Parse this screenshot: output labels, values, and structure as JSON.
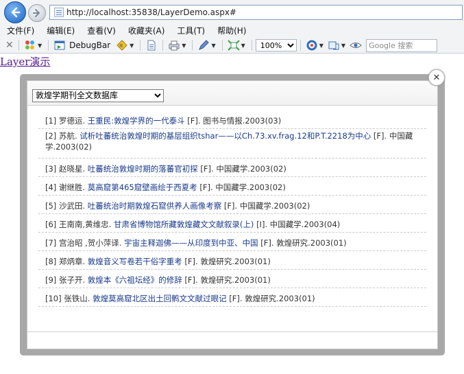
{
  "browser": {
    "url": "http://localhost:35838/LayerDemo.aspx#",
    "menu": [
      "文件(F)",
      "编辑(E)",
      "查看(V)",
      "收藏夹(A)",
      "工具(T)",
      "帮助(H)"
    ],
    "toolbar": {
      "close_glyph": "✕",
      "debugbar_label": "DebugBar",
      "zoom_value": "100%",
      "search_placeholder": "Google 搜索"
    }
  },
  "page": {
    "link_label": "Layer演示",
    "layer": {
      "close_glyph": "✕",
      "db_select_value": "敦煌学期刊全文数据库",
      "references": [
        {
          "idx": "[1]",
          "authors": "罗德运.",
          "title": "王重民:敦煌学界的一代泰斗",
          "type": "[F].",
          "source": "图书与情报.2003(03)"
        },
        {
          "idx": "[2]",
          "authors": "苏航.",
          "title": "试析吐蕃统治敦煌时期的基层组织tshar——以Ch.73.xv.frag.12和P.T.2218为中心",
          "type": "[F].",
          "source": "中国藏学.2003(02)"
        },
        {
          "idx": "[3]",
          "authors": "赵晓星.",
          "title": "吐蕃统治敦煌时期的落蕃官初探",
          "type": "[F].",
          "source": "中国藏学.2003(02)"
        },
        {
          "idx": "[4]",
          "authors": "谢继胜.",
          "title": "莫高窟第465窟壁画绘于西夏考",
          "type": "[F].",
          "source": "中国藏学.2003(02)"
        },
        {
          "idx": "[5]",
          "authors": "沙武田.",
          "title": "吐蕃统治时期敦煌石窟供养人画像考察",
          "type": "[F].",
          "source": "中国藏学.2003(02)"
        },
        {
          "idx": "[6]",
          "authors": "王南南,黄维忠.",
          "title": "甘肃省博物馆所藏敦煌藏文文献叙录(上)",
          "type": "[I].",
          "source": "中国藏学.2003(04)"
        },
        {
          "idx": "[7]",
          "authors": "宫治昭 ,贺小萍译.",
          "title": "宇宙主释迦佛——从印度到中亚、中国",
          "type": "[F].",
          "source": "敦煌研究.2003(01)"
        },
        {
          "idx": "[8]",
          "authors": "郑炳章.",
          "title": "敦煌音义写卷若干俗字重考",
          "type": "[F].",
          "source": "敦煌研究.2003(01)"
        },
        {
          "idx": "[9]",
          "authors": "张子开.",
          "title": "敦煌本《六祖坛经》的修辞",
          "type": "[F].",
          "source": "敦煌研究.2003(01)"
        },
        {
          "idx": "[10]",
          "authors": "张铁山.",
          "title": "敦煌莫高窟北区出土回鹘文文献过眼记",
          "type": "[F].",
          "source": "敦煌研究.2003(01)"
        }
      ]
    }
  }
}
